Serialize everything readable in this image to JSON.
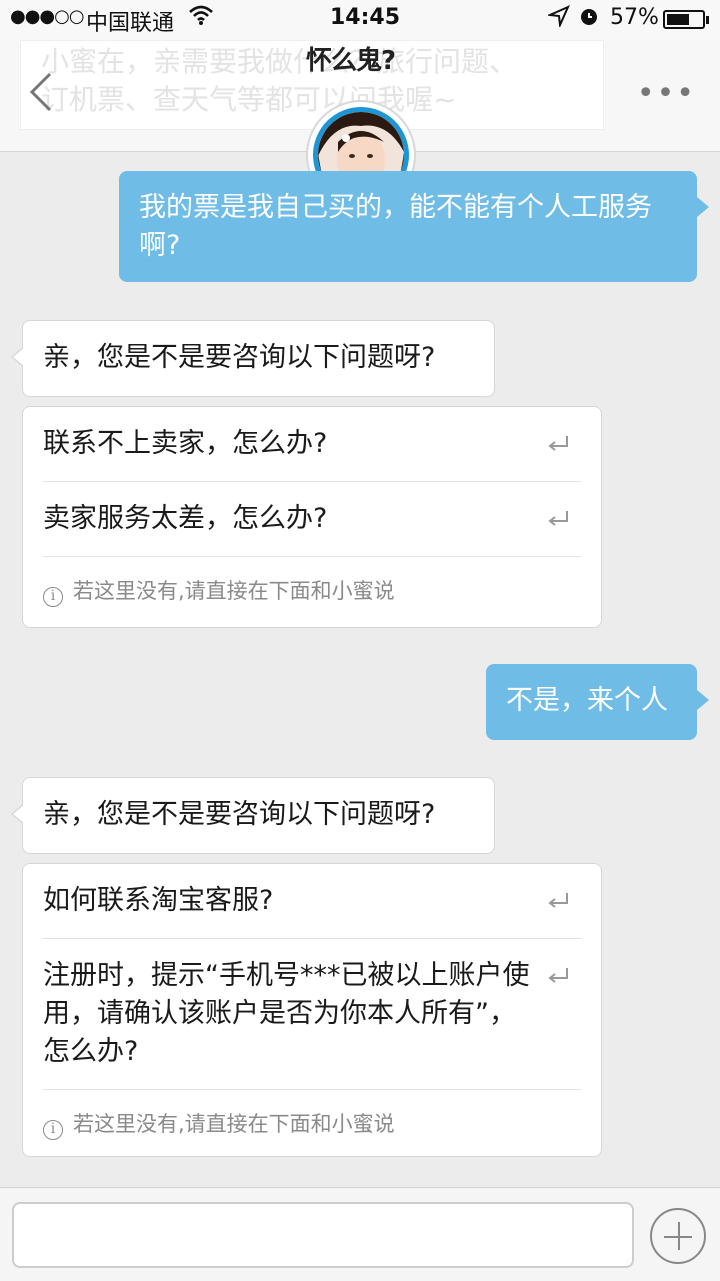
{
  "status_bar": {
    "signal": "●●●○○",
    "carrier": "中国联通",
    "time": "14:45",
    "battery": "57%",
    "battery_level": 0.57
  },
  "header": {
    "title_doodle": "怀么鬼?",
    "ghost_line_1": "小蜜在，亲需要我做什么？旅行问题、",
    "ghost_line_2": "订机票、查天气等都可以问我喔~"
  },
  "messages": {
    "out_1": "我的票是我自己买的，能不能有个人工服务啊?",
    "in_1": "亲，您是不是要咨询以下问题呀?",
    "card_1": {
      "q1": "联系不上卖家，怎么办?",
      "q2": "卖家服务太差，怎么办?",
      "hint": "若这里没有,请直接在下面和小蜜说"
    },
    "out_2": "不是，来个人",
    "in_2": "亲，您是不是要咨询以下问题呀?",
    "card_2": {
      "q1": "如何联系淘宝客服?",
      "q2": "注册时，提示“手机号***已被以上账户使用，请确认该账户是否为你本人所有”，怎么办?",
      "hint": "若这里没有,请直接在下面和小蜜说"
    }
  },
  "input": {
    "placeholder": ""
  },
  "colors": {
    "outgoing_bubble": "#6fbde6",
    "avatar_ring": "#1e95d4",
    "background": "#ececec"
  }
}
